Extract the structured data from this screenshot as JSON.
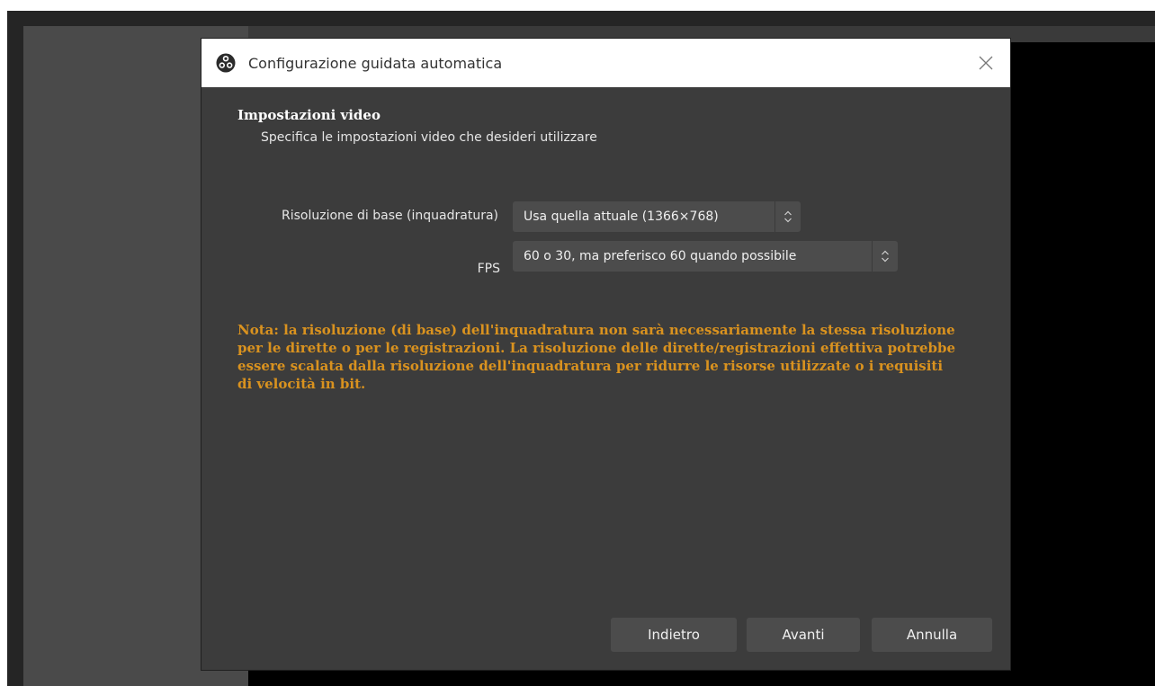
{
  "window": {
    "title": "Configurazione guidata automatica",
    "close_icon": "close-icon",
    "app_icon": "obs-logo-icon"
  },
  "page": {
    "heading": "Impostazioni video",
    "subheading": "Specifica le impostazioni video che desideri utilizzare"
  },
  "fields": {
    "resolution": {
      "label": "Risoluzione di base (inquadratura)",
      "value": "Usa quella attuale (1366×768)"
    },
    "fps": {
      "label": "FPS",
      "value": "60 o 30, ma preferisco 60 quando possibile"
    }
  },
  "note": "Nota: la risoluzione (di base) dell'inquadratura non sarà necessariamente la stessa risoluzione per le dirette o per le registrazioni. La risoluzione delle dirette/registrazioni effettiva potrebbe essere scalata dalla risoluzione dell'inquadratura per ridurre le risorse utilizzate o i requisiti di velocità in bit.",
  "buttons": {
    "back": "Indietro",
    "next": "Avanti",
    "cancel": "Annulla"
  },
  "colors": {
    "dialog_bg": "#3c3c3c",
    "note_text": "#d9921f",
    "control_bg": "#4c4c4c"
  }
}
